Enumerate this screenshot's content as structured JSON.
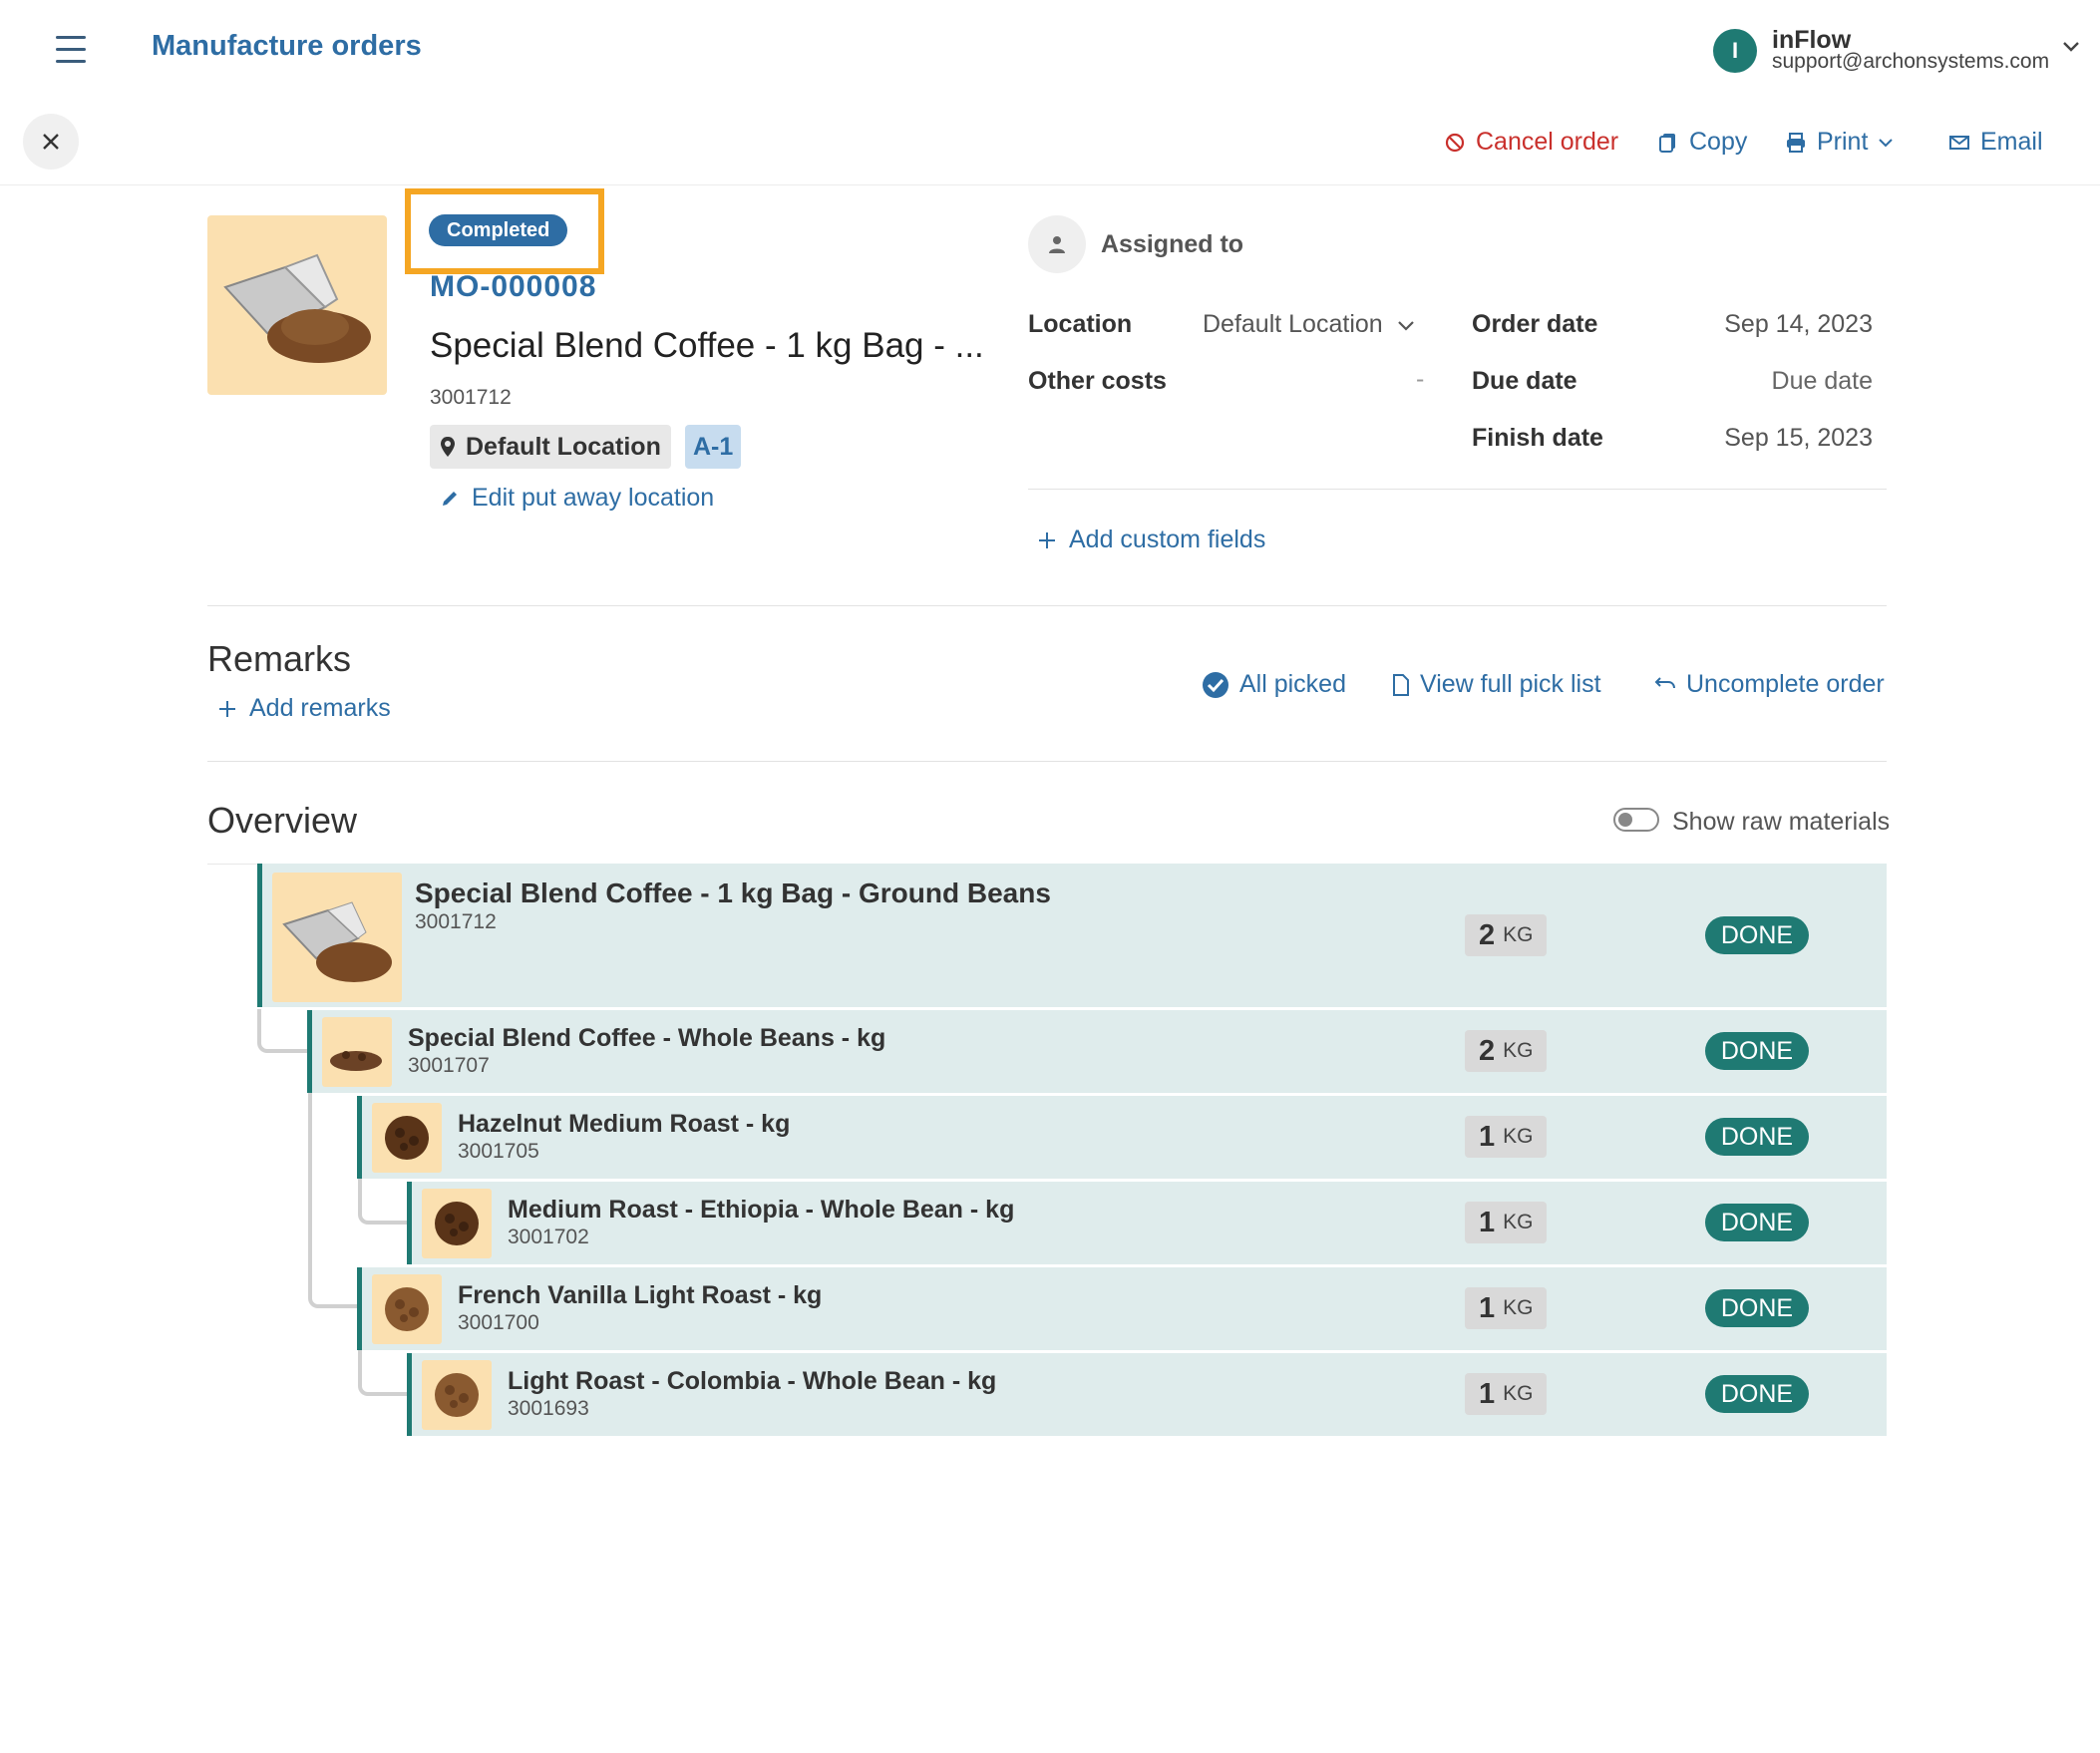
{
  "header": {
    "title": "Manufacture orders",
    "account_initial": "I",
    "account_name": "inFlow",
    "account_email": "support@archonsystems.com"
  },
  "toolbar": {
    "cancel_label": "Cancel order",
    "copy_label": "Copy",
    "print_label": "Print",
    "email_label": "Email"
  },
  "order": {
    "status": "Completed",
    "number": "MO-000008",
    "product_name": "Special Blend Coffee - 1 kg Bag - ...",
    "sku": "3001712",
    "location": "Default Location",
    "bin": "A-1",
    "edit_putaway": "Edit put away location"
  },
  "info": {
    "assigned_to": "Assigned to",
    "location_label": "Location",
    "location_value": "Default Location",
    "other_costs_label": "Other costs",
    "other_costs_value": "-",
    "order_date_label": "Order date",
    "order_date_value": "Sep 14, 2023",
    "due_date_label": "Due date",
    "due_date_value": "Due date",
    "finish_date_label": "Finish date",
    "finish_date_value": "Sep 15, 2023",
    "add_custom": "Add custom fields"
  },
  "remarks": {
    "title": "Remarks",
    "add": "Add remarks"
  },
  "actions": {
    "all_picked": "All picked",
    "view_pick": "View full pick list",
    "uncomplete": "Uncomplete order"
  },
  "overview": {
    "title": "Overview",
    "raw_toggle_label": "Show raw materials",
    "items": [
      {
        "name": "Special Blend Coffee - 1 kg Bag - Ground Beans",
        "sku": "3001712",
        "qty": "2",
        "unit": "KG",
        "status": "DONE"
      },
      {
        "name": "Special Blend Coffee - Whole Beans - kg",
        "sku": "3001707",
        "qty": "2",
        "unit": "KG",
        "status": "DONE"
      },
      {
        "name": "Hazelnut Medium Roast - kg",
        "sku": "3001705",
        "qty": "1",
        "unit": "KG",
        "status": "DONE"
      },
      {
        "name": "Medium Roast - Ethiopia - Whole Bean - kg",
        "sku": "3001702",
        "qty": "1",
        "unit": "KG",
        "status": "DONE"
      },
      {
        "name": "French Vanilla Light Roast - kg",
        "sku": "3001700",
        "qty": "1",
        "unit": "KG",
        "status": "DONE"
      },
      {
        "name": "Light Roast - Colombia - Whole Bean - kg",
        "sku": "3001693",
        "qty": "1",
        "unit": "KG",
        "status": "DONE"
      }
    ]
  },
  "colors": {
    "primary": "#2e6da4",
    "teal": "#1f7a73",
    "danger": "#c9302c",
    "highlight": "#f5a623"
  }
}
